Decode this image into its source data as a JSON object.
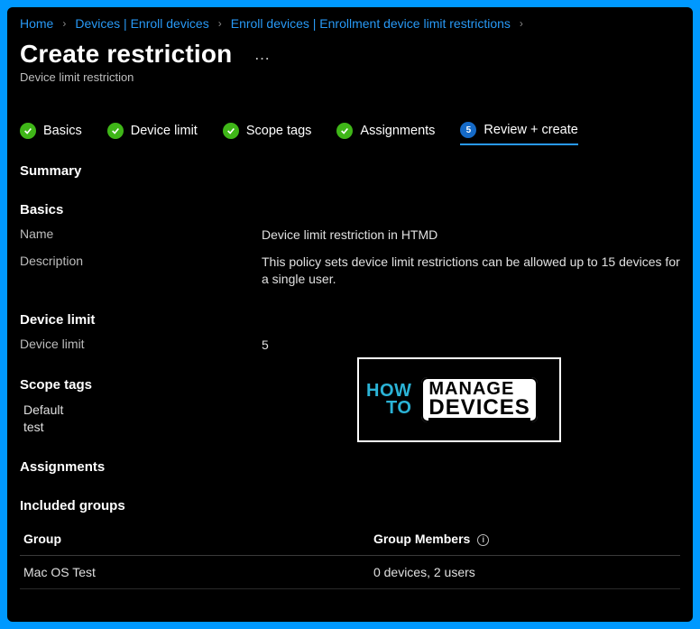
{
  "breadcrumb": [
    {
      "label": "Home"
    },
    {
      "label": "Devices | Enroll devices"
    },
    {
      "label": "Enroll devices | Enrollment device limit restrictions"
    }
  ],
  "page": {
    "title": "Create restriction",
    "subtitle": "Device limit restriction"
  },
  "steps": [
    {
      "label": "Basics",
      "state": "done"
    },
    {
      "label": "Device limit",
      "state": "done"
    },
    {
      "label": "Scope tags",
      "state": "done"
    },
    {
      "label": "Assignments",
      "state": "done"
    },
    {
      "label": "Review + create",
      "state": "current",
      "num": "5"
    }
  ],
  "summary_title": "Summary",
  "basics": {
    "heading": "Basics",
    "name_label": "Name",
    "name_value": "Device limit restriction in HTMD",
    "desc_label": "Description",
    "desc_value": "This policy sets device limit restrictions can be allowed up to 15 devices for a single user."
  },
  "device_limit": {
    "heading": "Device limit",
    "label": "Device limit",
    "value": "5"
  },
  "scope_tags": {
    "heading": "Scope tags",
    "items": [
      "Default",
      "test"
    ]
  },
  "assignments": {
    "heading": "Assignments",
    "included_heading": "Included groups",
    "table": {
      "col_group": "Group",
      "col_members": "Group Members",
      "rows": [
        {
          "group": "Mac OS Test",
          "members": "0 devices, 2 users"
        }
      ]
    }
  },
  "logo": {
    "how": "HOW",
    "to": "TO",
    "m1": "MANAGE",
    "m2": "DEVICES"
  }
}
